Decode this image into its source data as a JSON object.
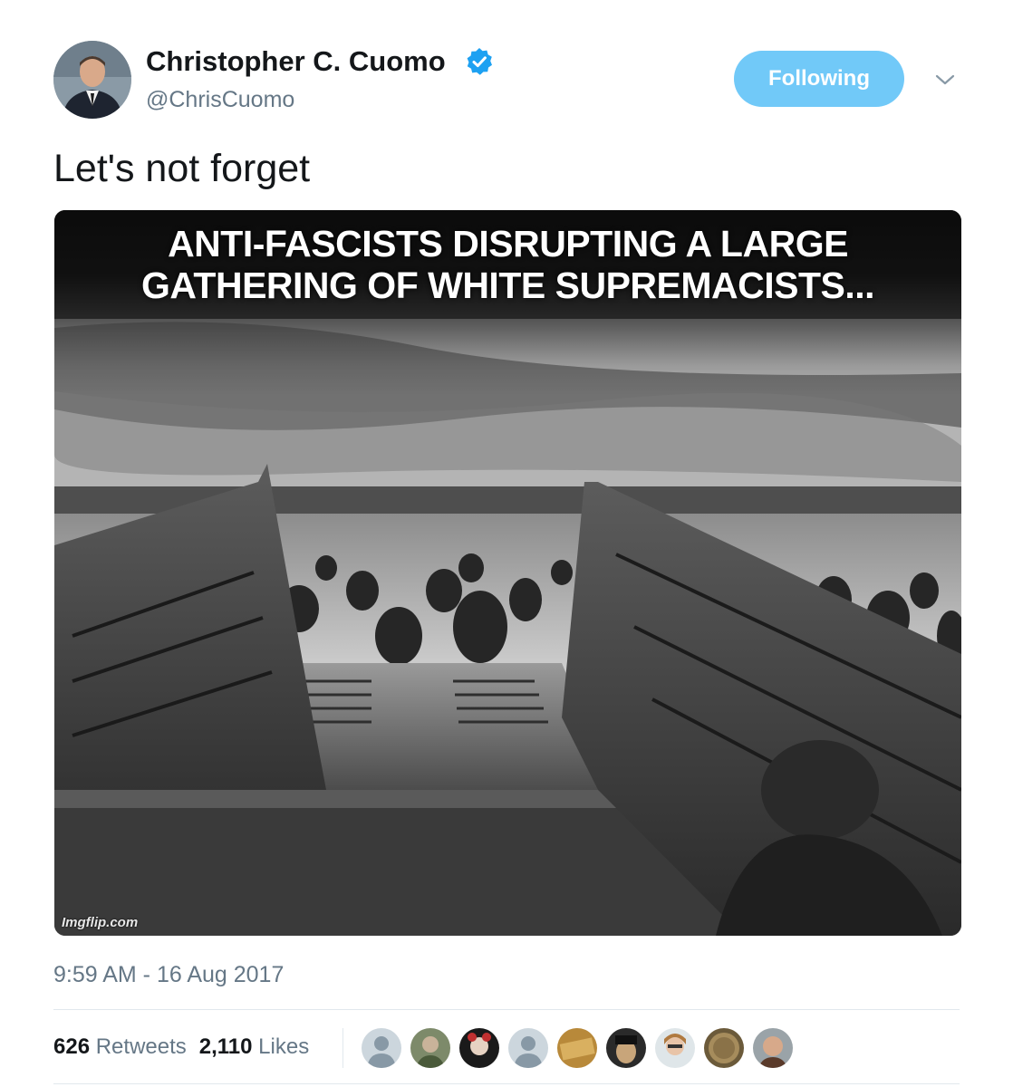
{
  "tweet": {
    "author": {
      "display_name": "Christopher C. Cuomo",
      "handle": "@ChrisCuomo",
      "verified": true,
      "avatar_icon": "profile-photo"
    },
    "follow_button_label": "Following",
    "more_icon": "chevron-down-icon",
    "text": "Let's not forget",
    "media": {
      "caption_line_1": "ANTI-FASCISTS DISRUPTING A LARGE",
      "caption_line_2": "GATHERING OF WHITE SUPREMACISTS...",
      "watermark": "Imgflip.com"
    },
    "timestamp": "9:59 AM - 16 Aug 2017",
    "stats": {
      "retweets_count": "626",
      "retweets_label": "Retweets",
      "likes_count": "2,110",
      "likes_label": "Likes"
    },
    "liker_avatars": [
      "default-avatar",
      "user-photo",
      "user-photo",
      "default-avatar",
      "user-photo",
      "user-photo",
      "user-photo",
      "coin-photo",
      "user-photo"
    ]
  },
  "colors": {
    "follow_button": "#71c9f8",
    "verified_badge": "#1da1f2",
    "secondary_text": "#657786",
    "primary_text": "#14171a",
    "divider": "#e1e8ed"
  }
}
